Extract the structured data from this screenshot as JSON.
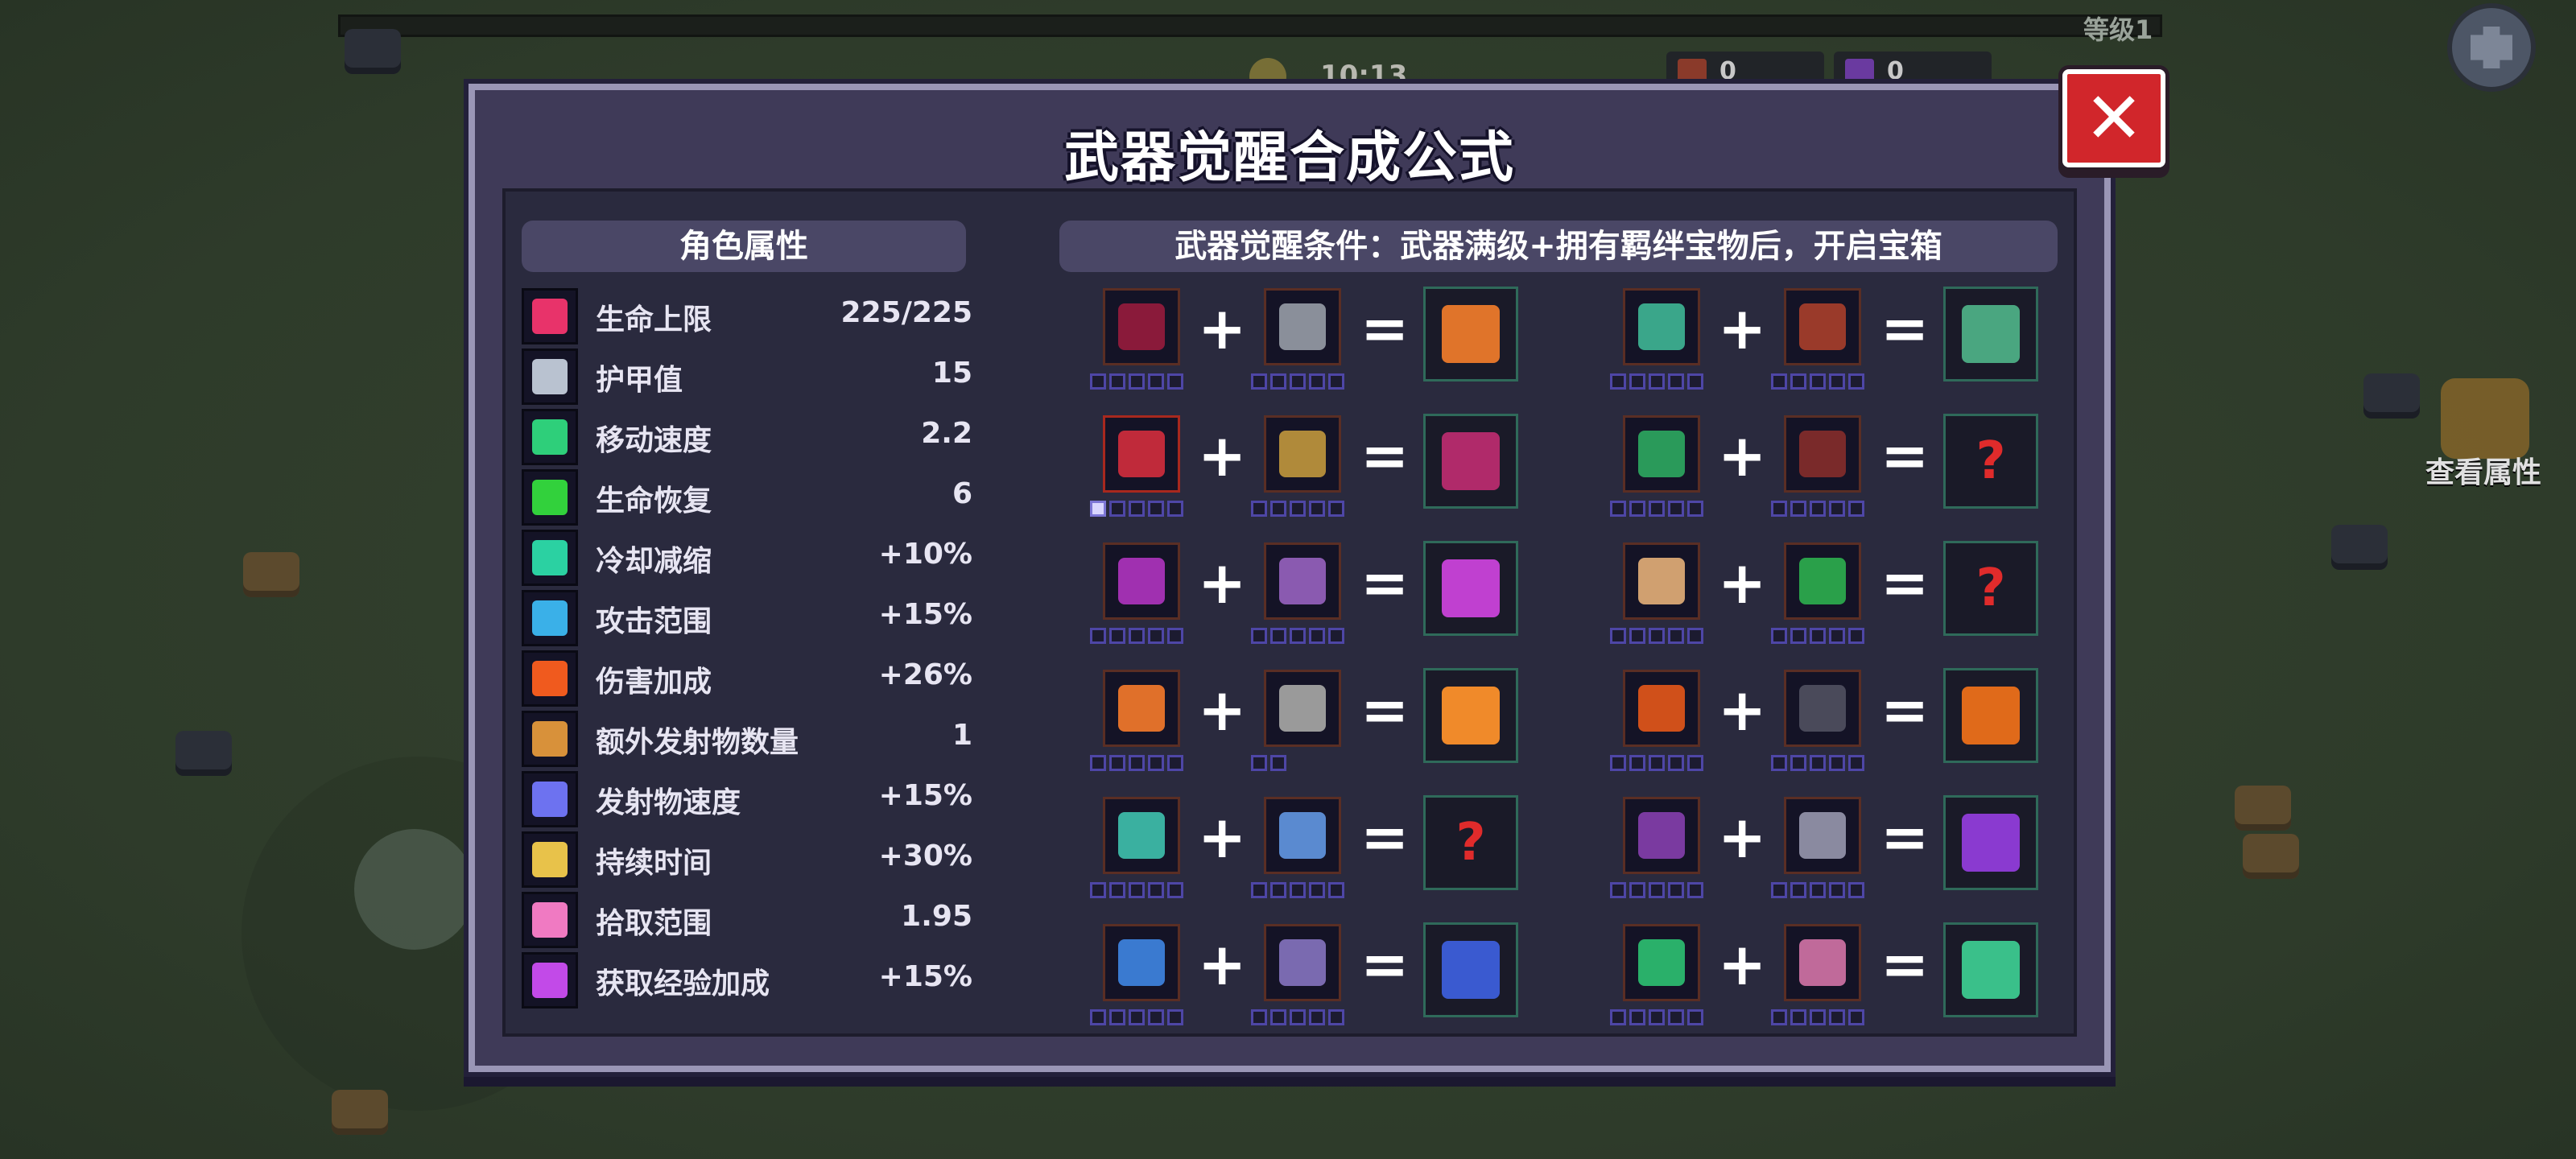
{
  "hud": {
    "level_text": "等级1",
    "timer": "10:13",
    "counter_a": "0",
    "counter_b": "0",
    "stats_button_label": "查看属性"
  },
  "modal": {
    "title": "武器觉醒合成公式",
    "close_label": "✕",
    "stats_header": "角色属性",
    "condition_header": "武器觉醒条件：武器满级+拥有羁绊宝物后，开启宝箱"
  },
  "stats": [
    {
      "label": "生命上限",
      "value": "225/225",
      "icon": "heart-icon",
      "color": "#e8336a"
    },
    {
      "label": "护甲值",
      "value": "15",
      "icon": "armor-icon",
      "color": "#b9c2d0"
    },
    {
      "label": "移动速度",
      "value": "2.2",
      "icon": "boot-icon",
      "color": "#2ecf7a"
    },
    {
      "label": "生命恢复",
      "value": "6",
      "icon": "cross-icon",
      "color": "#32d13c"
    },
    {
      "label": "冷却减缩",
      "value": "+10%",
      "icon": "hourglass-icon",
      "color": "#2bd1a2"
    },
    {
      "label": "攻击范围",
      "value": "+15%",
      "icon": "crosshair-icon",
      "color": "#3ab0e8"
    },
    {
      "label": "伤害加成",
      "value": "+26%",
      "icon": "flame-icon",
      "color": "#f05a1e"
    },
    {
      "label": "额外发射物数量",
      "value": "1",
      "icon": "arrows-icon",
      "color": "#d8913a"
    },
    {
      "label": "发射物速度",
      "value": "+15%",
      "icon": "speed-icon",
      "color": "#6d72f0"
    },
    {
      "label": "持续时间",
      "value": "+30%",
      "icon": "candle-icon",
      "color": "#e8c24a"
    },
    {
      "label": "拾取范围",
      "value": "1.95",
      "icon": "magnet-icon",
      "color": "#f07ac2"
    },
    {
      "label": "获取经验加成",
      "value": "+15%",
      "icon": "exp-icon",
      "color": "#c24ae8"
    }
  ],
  "recipes": [
    {
      "a": {
        "icon": "blood-crystal-icon",
        "color": "#8a1a3a",
        "stars": 5,
        "filled": 0
      },
      "b": {
        "icon": "helmet-icon",
        "color": "#8a8f9a",
        "stars": 5,
        "filled": 0
      },
      "result": {
        "icon": "awakened-sun-icon",
        "color": "#e0742a",
        "known": true
      }
    },
    {
      "a": {
        "icon": "fish-icon",
        "color": "#3aa68a",
        "stars": 5,
        "filled": 0
      },
      "b": {
        "icon": "amulet-icon",
        "color": "#9a3a2a",
        "stars": 5,
        "filled": 0
      },
      "result": {
        "icon": "awakened-dragon-icon",
        "color": "#4aa680",
        "known": true
      }
    },
    {
      "a": {
        "icon": "scythe-icon",
        "color": "#c02a3a",
        "stars": 5,
        "filled": 1,
        "red": true
      },
      "b": {
        "icon": "golden-helm-icon",
        "color": "#b08a3a",
        "stars": 5,
        "filled": 0
      },
      "result": {
        "icon": "awakened-scythe-icon",
        "color": "#b02a6a",
        "known": true
      }
    },
    {
      "a": {
        "icon": "herb-icon",
        "color": "#2a9a5a",
        "stars": 5,
        "filled": 0
      },
      "b": {
        "icon": "unknown-icon",
        "color": "#7a2a2a",
        "stars": 5,
        "filled": 0
      },
      "result": {
        "icon": "unknown-weapon-icon",
        "color": "#5a5a5a",
        "known": false
      }
    },
    {
      "a": {
        "icon": "trident-icon",
        "color": "#a030b0",
        "stars": 5,
        "filled": 0
      },
      "b": {
        "icon": "bat-icon",
        "color": "#8a5ab0",
        "stars": 5,
        "filled": 0
      },
      "result": {
        "icon": "awakened-trident-icon",
        "color": "#c040d0",
        "known": true
      }
    },
    {
      "a": {
        "icon": "skull-icon",
        "color": "#d0a070",
        "stars": 5,
        "filled": 0
      },
      "b": {
        "icon": "whip-icon",
        "color": "#2aa04a",
        "stars": 5,
        "filled": 0
      },
      "result": {
        "icon": "unknown-weapon-icon",
        "color": "#5a5a5a",
        "known": false
      }
    },
    {
      "a": {
        "icon": "carrot-icon",
        "color": "#e0702a",
        "stars": 5,
        "filled": 0
      },
      "b": {
        "icon": "tower-icon",
        "color": "#9a9a9a",
        "stars": 2,
        "filled": 0
      },
      "result": {
        "icon": "awakened-fire-icon",
        "color": "#f08a2a",
        "known": true
      }
    },
    {
      "a": {
        "icon": "fire-staff-icon",
        "color": "#d0501a",
        "stars": 5,
        "filled": 0
      },
      "b": {
        "icon": "shadow-armor-icon",
        "color": "#4a4a5a",
        "stars": 5,
        "filled": 0
      },
      "result": {
        "icon": "awakened-staff-icon",
        "color": "#e06a1a",
        "known": true
      }
    },
    {
      "a": {
        "icon": "lantern-icon",
        "color": "#3ab0a0",
        "stars": 5,
        "filled": 0
      },
      "b": {
        "icon": "chestplate-icon",
        "color": "#5a8ad0",
        "stars": 5,
        "filled": 0
      },
      "result": {
        "icon": "unknown-weapon-icon",
        "color": "#5a5a5a",
        "known": false
      }
    },
    {
      "a": {
        "icon": "demon-wing-icon",
        "color": "#7a3aa0",
        "stars": 5,
        "filled": 0
      },
      "b": {
        "icon": "wing-armor-icon",
        "color": "#8a8aa0",
        "stars": 5,
        "filled": 0
      },
      "result": {
        "icon": "awakened-wing-icon",
        "color": "#8a3ad0",
        "known": true
      }
    },
    {
      "a": {
        "icon": "blaster-icon",
        "color": "#3a7ad0",
        "stars": 5,
        "filled": 0
      },
      "b": {
        "icon": "necklace-icon",
        "color": "#7a6ab0",
        "stars": 5,
        "filled": 0
      },
      "result": {
        "icon": "awakened-blaster-icon",
        "color": "#3a5ad0",
        "known": true
      }
    },
    {
      "a": {
        "icon": "green-scroll-icon",
        "color": "#2ab06a",
        "stars": 5,
        "filled": 0
      },
      "b": {
        "icon": "orb-icon",
        "color": "#c06a9a",
        "stars": 5,
        "filled": 0
      },
      "result": {
        "icon": "awakened-scroll-icon",
        "color": "#3ac08a",
        "known": true
      }
    }
  ]
}
